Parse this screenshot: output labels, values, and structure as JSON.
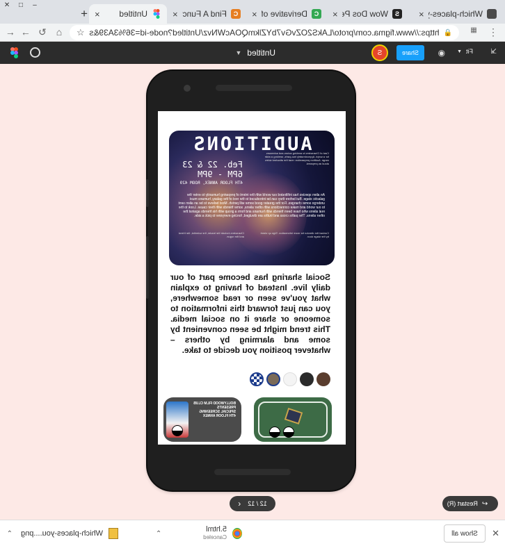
{
  "browser": {
    "tabs": [
      {
        "label": "Which-places-you...",
        "icon_color": "#4a4a4a",
        "icon_text": "S"
      },
      {
        "label": "Wow Dos People",
        "icon_color": "#222222",
        "icon_text": "S"
      },
      {
        "label": "Derivative of x^2",
        "icon_color": "#34a853",
        "icon_text": "C"
      },
      {
        "label": "Find A Function",
        "icon_color": "#e67e22",
        "icon_text": "C"
      },
      {
        "label": "Untitled",
        "icon_color": "#a259ff",
        "icon_text": ""
      }
    ],
    "new_tab": "+",
    "url": "https://www.figma.com/proto/LAkS2OZvGv7bYZlkmQOAcWNvz/Untitled?node-id=36%3A39&scaling=sca..."
  },
  "figma": {
    "file_title": "Untitled",
    "share_label": "Share",
    "avatar_initial": "S",
    "fit_label": "Fit",
    "accent": "#18a0fb"
  },
  "poster": {
    "title": "AUDITIONS",
    "date": "Feb. 22 & 23",
    "time": "6PM - 9PM",
    "location": "4TH FLOOR ANNEX, ROOM 429",
    "body": "An alien species has infiltrated our world with the intent of preparing humanity to enter the galactic stage. But before they can be introduced to the rest of the galaxy, humans must undergo some changes. For the greater good some will perish. Most believe to be an alien sent to our world and make connections with other aliens, some friends with their cause. Look to the real aliens who have been friends with humans and form a group with his friends against the other aliens. The paths cross and truths are divulged, forcing everyone to pick a side.",
    "col_left": "Cast of Characters is seeking actors and actresses for a script. Approximately two-parts, seeking a wide range. Audition preparation: read the attached sides aloud as prepared.",
    "col_right": "The script will be sent out when the group has been selected. Bring prepared pieces and availability on the day.",
    "foot_left": "Contact the director for more information. Sign up sheet by the stage door.",
    "foot_right": "Characters include the leader, the scientist, the friend and the rogue."
  },
  "article": {
    "text": "Social sharing has become part of our daily live. Instead of having to explain what you've seen or read somewhere, you can just forward this information to someone or share it on social media. This trend might be seen convenient by some and alarming by others – whatever position you decide to take."
  },
  "cards": {
    "dark_text": "BOLLYWOOD FILM CLUB PRESENTS\nSPECIAL SCREENING\n4TH FLOOR ANNEX"
  },
  "proto": {
    "restart_label": "Restart (R)",
    "page_indicator": "12 / 12"
  },
  "downloads": {
    "items": [
      {
        "name": "Which-places-you....png",
        "status": ""
      },
      {
        "name": "5.html",
        "status": "Canceled"
      }
    ],
    "show_all": "Show all"
  }
}
